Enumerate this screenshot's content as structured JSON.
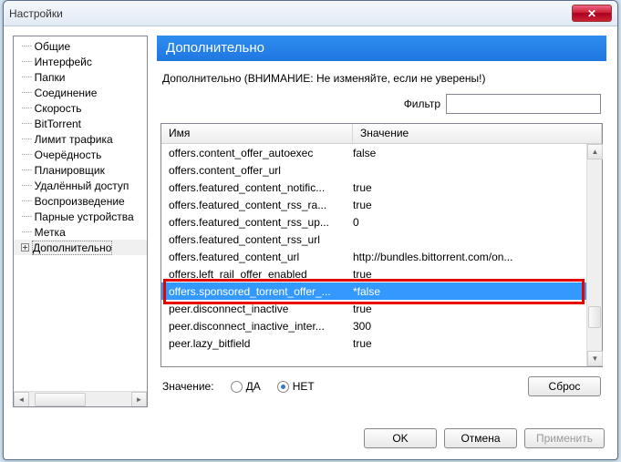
{
  "window": {
    "title": "Настройки"
  },
  "tree": {
    "items": [
      "Общие",
      "Интерфейс",
      "Папки",
      "Соединение",
      "Скорость",
      "BitTorrent",
      "Лимит трафика",
      "Очерёдность",
      "Планировщик",
      "Удалённый доступ",
      "Воспроизведение",
      "Парные устройства",
      "Метка",
      "Дополнительно"
    ],
    "selected_index": 13
  },
  "banner": "Дополнительно",
  "warning": "Дополнительно (ВНИМАНИЕ: Не изменяйте, если не уверены!)",
  "filter": {
    "label": "Фильтр",
    "value": ""
  },
  "table": {
    "columns": {
      "name": "Имя",
      "value": "Значение"
    },
    "rows": [
      {
        "name": "offers.content_offer_autoexec",
        "value": "false"
      },
      {
        "name": "offers.content_offer_url",
        "value": ""
      },
      {
        "name": "offers.featured_content_notific...",
        "value": "true"
      },
      {
        "name": "offers.featured_content_rss_ra...",
        "value": "true"
      },
      {
        "name": "offers.featured_content_rss_up...",
        "value": "0"
      },
      {
        "name": "offers.featured_content_rss_url",
        "value": ""
      },
      {
        "name": "offers.featured_content_url",
        "value": "http://bundles.bittorrent.com/on..."
      },
      {
        "name": "offers.left_rail_offer_enabled",
        "value": "true"
      },
      {
        "name": "offers.sponsored_torrent_offer_...",
        "value": "*false",
        "selected": true
      },
      {
        "name": "peer.disconnect_inactive",
        "value": "true"
      },
      {
        "name": "peer.disconnect_inactive_inter...",
        "value": "300"
      },
      {
        "name": "peer.lazy_bitfield",
        "value": "true"
      }
    ]
  },
  "value_editor": {
    "label": "Значение:",
    "options": {
      "yes": "ДА",
      "no": "НЕТ"
    },
    "selected": "no",
    "reset": "Сброс"
  },
  "buttons": {
    "ok": "OK",
    "cancel": "Отмена",
    "apply": "Применить"
  }
}
